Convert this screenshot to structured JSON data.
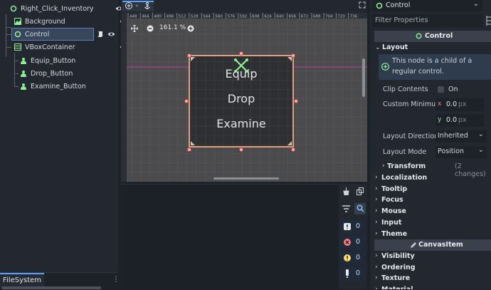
{
  "scene_tree": {
    "nodes": [
      {
        "label": "Right_Click_Inventory",
        "icon": "control-node-icon"
      },
      {
        "label": "Background",
        "icon": "texture-rect-icon"
      },
      {
        "label": "Control",
        "icon": "control-node-icon"
      },
      {
        "label": "VBoxContainer",
        "icon": "vbox-container-icon"
      },
      {
        "label": "Equip_Button",
        "icon": "button-node-icon"
      },
      {
        "label": "Drop_Button",
        "icon": "button-node-icon"
      },
      {
        "label": "Examine_Button",
        "icon": "button-node-icon"
      }
    ]
  },
  "filesystem": {
    "tab_label": "FileSystem"
  },
  "viewport": {
    "zoom_label": "161.1 %",
    "ruler_ticks": [
      "448",
      "464",
      "480",
      "496",
      "512",
      "528",
      "544",
      "560",
      "576",
      "592",
      "608",
      "624",
      "640",
      "656",
      "672",
      "688",
      "704",
      "720",
      "736"
    ],
    "buttons": [
      "Equip",
      "Drop",
      "Examine"
    ]
  },
  "console": {
    "counts": [
      "0",
      "0",
      "0",
      "0"
    ]
  },
  "inspector": {
    "node_name": "Control",
    "filter_placeholder": "Filter Properties",
    "class_header": "Control",
    "layout_title": "Layout",
    "info_text_1": "This node is a child of a",
    "info_text_2": "regular control.",
    "clip_contents_label": "Clip Contents",
    "clip_contents_value": "On",
    "custom_min_label": "Custom Minimu",
    "min_x_axis": "x",
    "min_x": "0.0",
    "min_y_axis": "y",
    "min_y": "0.0",
    "unit": "px",
    "layout_direction_label": "Layout Direction",
    "layout_direction_value": "Inherited",
    "layout_mode_label": "Layout Mode",
    "layout_mode_value": "Position",
    "transform_label": "Transform",
    "transform_changes": "(2 changes)",
    "sections": [
      "Localization",
      "Tooltip",
      "Focus",
      "Mouse",
      "Input",
      "Theme"
    ],
    "canvas_item_header": "CanvasItem",
    "canvas_sections": [
      "Visibility",
      "Ordering",
      "Texture",
      "Material"
    ]
  },
  "colors": {
    "accent": "#57a3ff",
    "node_green": "#8eef97",
    "selection_border": "#e0a080",
    "info_bg": "#2f3c4d"
  }
}
